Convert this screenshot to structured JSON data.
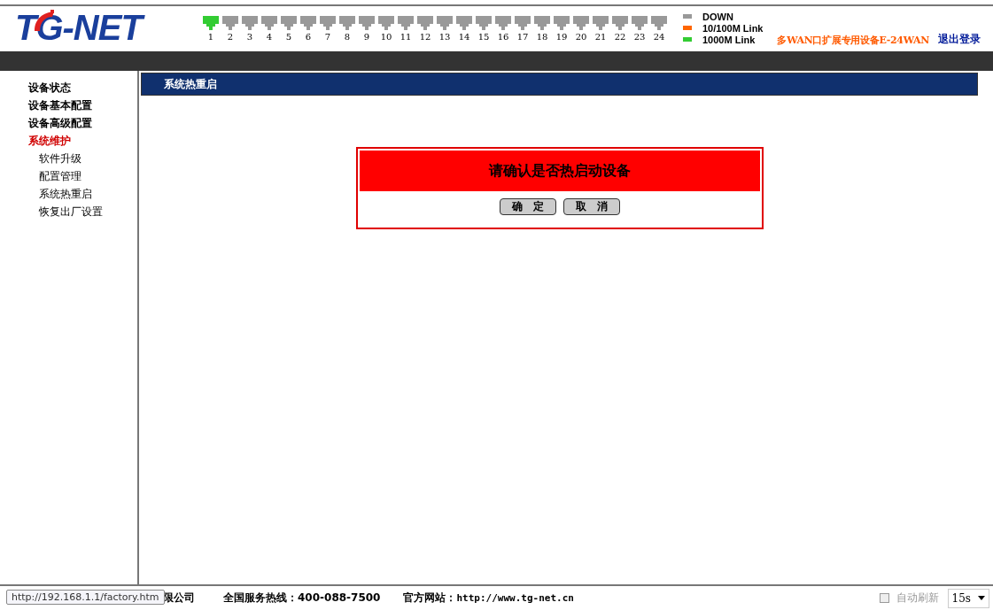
{
  "header": {
    "logo": "TG-NET",
    "ports": [
      {
        "label": "1",
        "color": "#33cc33"
      },
      {
        "label": "2",
        "color": "#999999"
      },
      {
        "label": "3",
        "color": "#999999"
      },
      {
        "label": "4",
        "color": "#999999"
      },
      {
        "label": "5",
        "color": "#999999"
      },
      {
        "label": "6",
        "color": "#999999"
      },
      {
        "label": "7",
        "color": "#999999"
      },
      {
        "label": "8",
        "color": "#999999"
      },
      {
        "label": "9",
        "color": "#999999"
      },
      {
        "label": "10",
        "color": "#999999"
      },
      {
        "label": "11",
        "color": "#999999"
      },
      {
        "label": "12",
        "color": "#999999"
      },
      {
        "label": "13",
        "color": "#999999"
      },
      {
        "label": "14",
        "color": "#999999"
      },
      {
        "label": "15",
        "color": "#999999"
      },
      {
        "label": "16",
        "color": "#999999"
      },
      {
        "label": "17",
        "color": "#999999"
      },
      {
        "label": "18",
        "color": "#999999"
      },
      {
        "label": "19",
        "color": "#999999"
      },
      {
        "label": "20",
        "color": "#999999"
      },
      {
        "label": "21",
        "color": "#999999"
      },
      {
        "label": "22",
        "color": "#999999"
      },
      {
        "label": "23",
        "color": "#999999"
      },
      {
        "label": "24",
        "color": "#999999"
      }
    ],
    "legend": [
      {
        "label": "DOWN",
        "color": "#999999"
      },
      {
        "label": "10/100M Link",
        "color": "#ff6600"
      },
      {
        "label": "1000M Link",
        "color": "#33cc33"
      }
    ],
    "device_name": "多WAN口扩展专用设备E-24WAN",
    "logout": "退出登录"
  },
  "sidebar": {
    "items": [
      {
        "label": "设备状态",
        "selected": false
      },
      {
        "label": "设备基本配置",
        "selected": false
      },
      {
        "label": "设备高级配置",
        "selected": false
      },
      {
        "label": "系统维护",
        "selected": true,
        "children": [
          {
            "label": "软件升级",
            "selected": false
          },
          {
            "label": "配置管理",
            "selected": false
          },
          {
            "label": "系统热重启",
            "selected": false
          },
          {
            "label": "恢复出厂设置",
            "selected": false
          }
        ]
      }
    ]
  },
  "main": {
    "title": "系统热重启",
    "dialog": {
      "message": "请确认是否热启动设备",
      "buttons": [
        "确　定",
        "取　消"
      ]
    }
  },
  "footer": {
    "company": "限公司",
    "hotline": "全国服务热线：400-088-7500",
    "website_label": "官方网站：",
    "website": "http://www.tg-net.cn",
    "auto_refresh": {
      "label": "自动刷新",
      "checked": false
    },
    "interval": "15s"
  },
  "status_tooltip": "http://192.168.1.1/factory.htm"
}
